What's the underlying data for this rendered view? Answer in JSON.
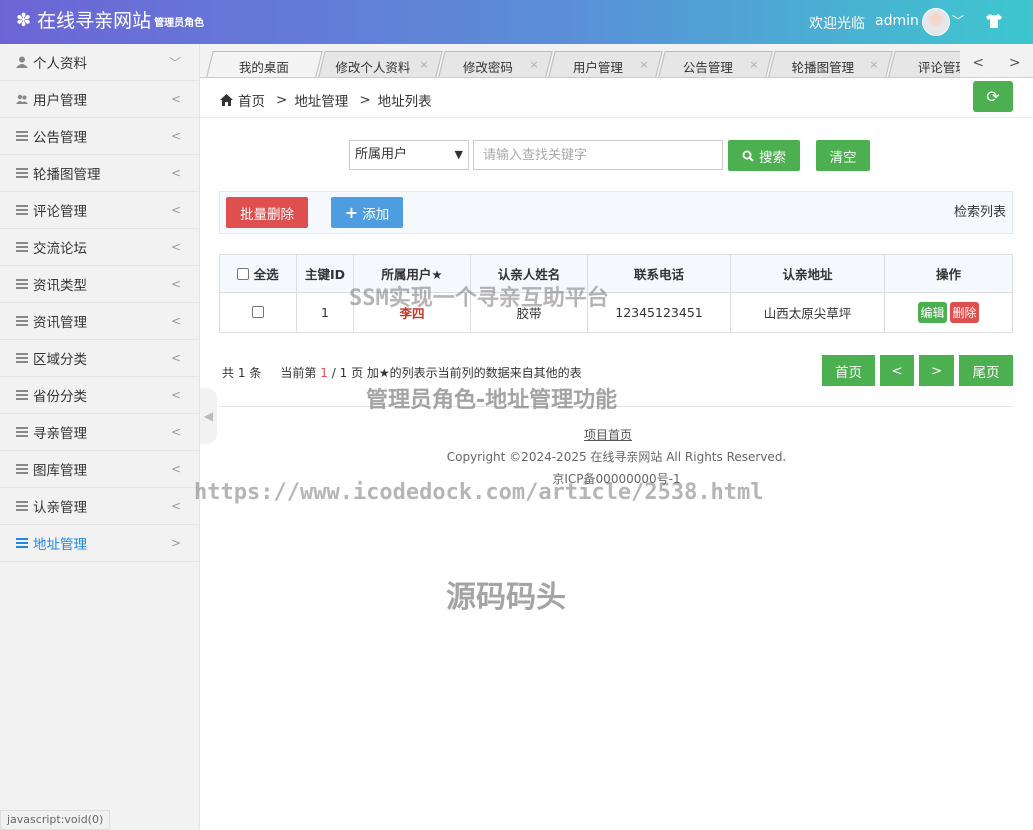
{
  "header": {
    "title": "在线寻亲网站",
    "role": "管理员角色",
    "welcome": "欢迎光临",
    "username": "admin"
  },
  "sidebar": {
    "items": [
      {
        "label": "个人资料",
        "arrow": "﹀"
      },
      {
        "label": "用户管理",
        "arrow": "<"
      },
      {
        "label": "公告管理",
        "arrow": "<"
      },
      {
        "label": "轮播图管理",
        "arrow": "<"
      },
      {
        "label": "评论管理",
        "arrow": "<"
      },
      {
        "label": "交流论坛",
        "arrow": "<"
      },
      {
        "label": "资讯类型",
        "arrow": "<"
      },
      {
        "label": "资讯管理",
        "arrow": "<"
      },
      {
        "label": "区域分类",
        "arrow": "<"
      },
      {
        "label": "省份分类",
        "arrow": "<"
      },
      {
        "label": "寻亲管理",
        "arrow": "<"
      },
      {
        "label": "图库管理",
        "arrow": "<"
      },
      {
        "label": "认亲管理",
        "arrow": "<"
      },
      {
        "label": "地址管理",
        "arrow": ">"
      }
    ],
    "active_index": 13
  },
  "tabs": [
    {
      "label": "我的桌面"
    },
    {
      "label": "修改个人资料"
    },
    {
      "label": "修改密码"
    },
    {
      "label": "用户管理"
    },
    {
      "label": "公告管理"
    },
    {
      "label": "轮播图管理"
    },
    {
      "label": "评论管理"
    }
  ],
  "tab_nav": {
    "prev": "<",
    "next": ">"
  },
  "breadcrumb": {
    "home": "首页",
    "level1": "地址管理",
    "level2": "地址列表",
    "sep": ">"
  },
  "search": {
    "field_selected": "所属用户",
    "placeholder": "请输入查找关键字",
    "search_label": "搜索",
    "clear_label": "清空"
  },
  "toolbar": {
    "batch_delete": "批量删除",
    "add": "添加",
    "title": "检索列表"
  },
  "table": {
    "select_all": "全选",
    "headers": [
      "主键ID",
      "所属用户★",
      "认亲人姓名",
      "联系电话",
      "认亲地址",
      "操作"
    ],
    "rows": [
      {
        "id": "1",
        "user": "李四",
        "name": "胶带",
        "phone": "12345123451",
        "address": "山西太原尖草坪",
        "edit": "编辑",
        "delete": "删除"
      }
    ]
  },
  "pager": {
    "total_prefix": "共",
    "total": "1",
    "total_suffix": "条",
    "current_prefix": "当前第",
    "current": "1",
    "separator": "/",
    "pages": "1",
    "pages_suffix": "页",
    "note": "加★的列表示当前列的数据来自其他的表",
    "first": "首页",
    "prev": "<",
    "next": ">",
    "last": "尾页"
  },
  "footer": {
    "link": "项目首页",
    "copyright": "Copyright ©2024-2025 在线寻亲网站 All Rights Reserved.",
    "icp": "京ICP备00000000号-1"
  },
  "status_bar": "javascript:void(0)",
  "watermarks": [
    "SSM实现一个寻亲互助平台",
    "管理员角色-地址管理功能",
    "https://www.icodedock.com/article/2538.html",
    "源码码头"
  ],
  "colors": {
    "header_gradient_start": "#6d65d6",
    "header_gradient_end": "#3ec7cf",
    "primary_green": "#4caf50",
    "danger_red": "#e04f4f",
    "info_blue": "#4d9de0",
    "active_link": "#1e88e5"
  }
}
